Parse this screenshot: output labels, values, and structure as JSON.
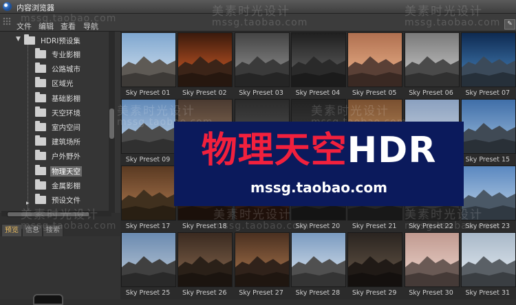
{
  "window": {
    "title": "内容浏览器"
  },
  "menu": [
    "文件",
    "编辑",
    "查看",
    "导航"
  ],
  "tree": {
    "root": "HDRI预设集",
    "items": [
      "专业影棚",
      "公路城市",
      "区域光",
      "基础影棚",
      "天空环境",
      "室内空间",
      "建筑场所",
      "户外野外",
      "物理天空",
      "金属影棚",
      "预设文件"
    ],
    "selected": "物理天空"
  },
  "tabs": [
    "预览",
    "信息",
    "搜索"
  ],
  "presets": [
    {
      "label": "Sky Preset 01",
      "sky": [
        "#7fa7d0",
        "#d8e4ef"
      ],
      "mtn": "#5e5a55"
    },
    {
      "label": "Sky Preset 02",
      "sky": [
        "#3a1a0c",
        "#e0622a"
      ],
      "mtn": "#3b2418"
    },
    {
      "label": "Sky Preset 03",
      "sky": [
        "#444",
        "#9a9a9a"
      ],
      "mtn": "#3a3a3a"
    },
    {
      "label": "Sky Preset 04",
      "sky": [
        "#1f1f1f",
        "#6a6a6a"
      ],
      "mtn": "#2a2a2a"
    },
    {
      "label": "Sky Preset 05",
      "sky": [
        "#b07050",
        "#f0b890"
      ],
      "mtn": "#5a4036"
    },
    {
      "label": "Sky Preset 06",
      "sky": [
        "#7a7a7a",
        "#d0d0d0"
      ],
      "mtn": "#4a4a4a"
    },
    {
      "label": "Sky Preset 07",
      "sky": [
        "#0e2a52",
        "#4a88c0"
      ],
      "mtn": "#3b4a5a"
    },
    {
      "label": "Sky Preset 09",
      "sky": [
        "#5f88b8",
        "#c8d8e8"
      ],
      "mtn": "#4b4b4b"
    },
    {
      "label": "",
      "sky": [
        "#4a3a30",
        "#9a7a60"
      ],
      "mtn": "#3a2e28"
    },
    {
      "label": "",
      "sky": [
        "#2a2a2a",
        "#5a5a5a"
      ],
      "mtn": "#222"
    },
    {
      "label": "",
      "sky": [
        "#222",
        "#444"
      ],
      "mtn": "#1a1a1a"
    },
    {
      "label": "",
      "sky": [
        "#7a5030",
        "#c09060"
      ],
      "mtn": "#4a3020"
    },
    {
      "label": "",
      "sky": [
        "#8aa0c0",
        "#d0d8e0"
      ],
      "mtn": "#555"
    },
    {
      "label": "Sky Preset 15",
      "sky": [
        "#3f6ea8",
        "#a0c0e0"
      ],
      "mtn": "#404a55"
    },
    {
      "label": "Sky Preset 17",
      "sky": [
        "#5a3a22",
        "#b07a50"
      ],
      "mtn": "#40301e"
    },
    {
      "label": "Sky Preset 18",
      "sky": [
        "#3a2010",
        "#8a4020"
      ],
      "mtn": "#2a1a10"
    },
    {
      "label": "",
      "sky": [
        "#4a2a18",
        "#a05a30"
      ],
      "mtn": "#301a10"
    },
    {
      "label": "Sky Preset 20",
      "sky": [
        "#2a2a2a",
        "#606060"
      ],
      "mtn": "#202020"
    },
    {
      "label": "Sky Preset 21",
      "sky": [
        "#2f2f2f",
        "#707070"
      ],
      "mtn": "#262626"
    },
    {
      "label": "Sky Preset 22",
      "sky": [
        "#4a4a4a",
        "#8a8a8a"
      ],
      "mtn": "#333"
    },
    {
      "label": "Sky Preset 23",
      "sky": [
        "#5a88c0",
        "#c0d4e8"
      ],
      "mtn": "#4a5866"
    },
    {
      "label": "Sky Preset 25",
      "sky": [
        "#6a8ab0",
        "#c0ccd8"
      ],
      "mtn": "#404040"
    },
    {
      "label": "Sky Preset 26",
      "sky": [
        "#3a2a20",
        "#8a6a50"
      ],
      "mtn": "#2a2018"
    },
    {
      "label": "Sky Preset 27",
      "sky": [
        "#4a3020",
        "#b07a50"
      ],
      "mtn": "#30221a"
    },
    {
      "label": "Sky Preset 28",
      "sky": [
        "#7a9ac0",
        "#e0e8f0"
      ],
      "mtn": "#505050"
    },
    {
      "label": "Sky Preset 29",
      "sky": [
        "#2a2420",
        "#6a5a4a"
      ],
      "mtn": "#201a16"
    },
    {
      "label": "Sky Preset 30",
      "sky": [
        "#c09a90",
        "#f0d8d0"
      ],
      "mtn": "#6a5a55"
    },
    {
      "label": "Sky Preset 31",
      "sky": [
        "#a8b8c8",
        "#e8eef4"
      ],
      "mtn": "#5a6066"
    }
  ],
  "watermark": {
    "name": "美素时光设计",
    "url": "mssg.taobao.com"
  },
  "banner": {
    "title_red": "物理天空",
    "title_white": "HDR",
    "url": "mssg.taobao.com"
  }
}
